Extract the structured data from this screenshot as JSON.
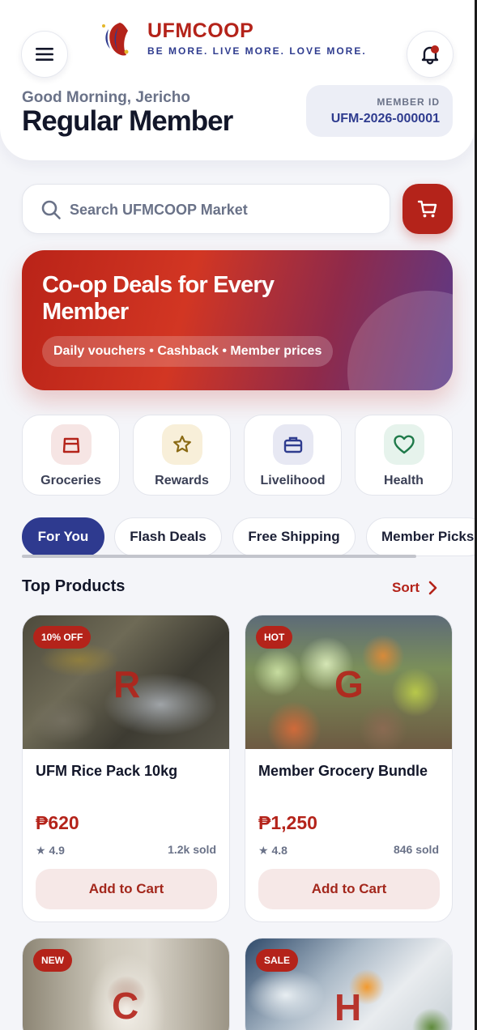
{
  "colors": {
    "brand_red": "#b4231a",
    "brand_navy": "#2f3c8f",
    "background": "#f4f5f9"
  },
  "header": {
    "brand_name": "UFMCOOP",
    "tagline": "BE MORE. LIVE MORE. LOVE MORE.",
    "greeting": "Good Morning, Jericho",
    "member_type": "Regular Member",
    "member_id_label": "MEMBER ID",
    "member_id": "UFM-2026-000001",
    "menu_icon": "hamburger-menu-icon",
    "bell_icon": "bell-icon"
  },
  "search": {
    "placeholder": "Search UFMCOOP Market",
    "icon": "search-icon",
    "cart_icon": "cart-icon"
  },
  "banner": {
    "title": "Co-op Deals for Every Member",
    "pill": "Daily vouchers • Cashback • Member prices"
  },
  "categories": [
    {
      "label": "Groceries",
      "icon": "shopping-bag-icon"
    },
    {
      "label": "Rewards",
      "icon": "star-icon"
    },
    {
      "label": "Livelihood",
      "icon": "briefcase-icon"
    },
    {
      "label": "Health",
      "icon": "heart-icon"
    }
  ],
  "tabs": [
    {
      "label": "For You",
      "active": true
    },
    {
      "label": "Flash Deals",
      "active": false
    },
    {
      "label": "Free Shipping",
      "active": false
    },
    {
      "label": "Member Picks",
      "active": false
    }
  ],
  "section": {
    "title": "Top Products",
    "sort_label": "Sort"
  },
  "products": [
    {
      "badge": "10% OFF",
      "letter": "R",
      "name": "UFM Rice Pack 10kg",
      "price": "₱620",
      "rating": "★ 4.9",
      "sold": "1.2k sold",
      "cta": "Add to Cart"
    },
    {
      "badge": "HOT",
      "letter": "G",
      "name": "Member Grocery Bundle",
      "price": "₱1,250",
      "rating": "★ 4.8",
      "sold": "846 sold",
      "cta": "Add to Cart"
    },
    {
      "badge": "NEW",
      "letter": "C"
    },
    {
      "badge": "SALE",
      "letter": "H"
    }
  ]
}
